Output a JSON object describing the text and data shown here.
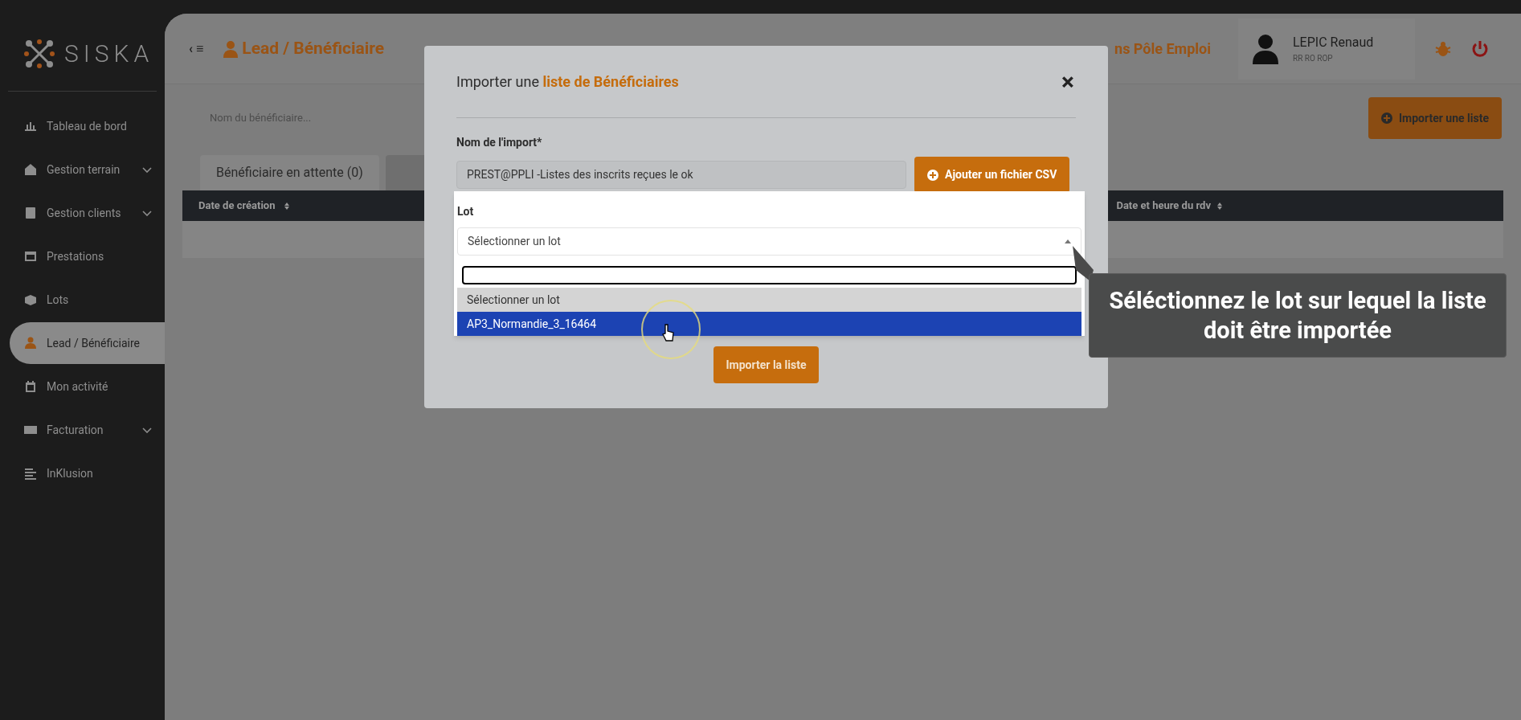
{
  "sidebar": {
    "logo": "SISKA",
    "items": [
      {
        "label": "Tableau de bord",
        "submenu": false,
        "selected": false
      },
      {
        "label": "Gestion terrain",
        "submenu": true,
        "selected": false
      },
      {
        "label": "Gestion clients",
        "submenu": true,
        "selected": false
      },
      {
        "label": "Prestations",
        "submenu": false,
        "selected": false
      },
      {
        "label": "Lots",
        "submenu": false,
        "selected": false
      },
      {
        "label": "Lead / Bénéficiaire",
        "submenu": false,
        "selected": true
      },
      {
        "label": "Mon activité",
        "submenu": false,
        "selected": false
      },
      {
        "label": "Facturation",
        "submenu": true,
        "selected": false
      },
      {
        "label": "InKlusion",
        "submenu": false,
        "selected": false
      }
    ]
  },
  "header": {
    "toggle": "‹ ≡",
    "title": "Lead / Bénéficiaire",
    "link": "ns Pôle Emploi",
    "user_name": "LEPIC Renaud",
    "user_role": "RR RO ROP"
  },
  "toolbar": {
    "search_placeholder": "Nom du bénéficiaire...",
    "import_button": "Importer une liste"
  },
  "tabs": [
    {
      "label": "Bénéficiaire en attente (0)",
      "selected": true
    },
    {
      "selected": false
    }
  ],
  "table": {
    "columns": [
      "Date de création",
      "Date et heure du rdv"
    ]
  },
  "modal": {
    "title_plain": "Importer une ",
    "title_accent": "liste de Bénéficiaires",
    "close": "×",
    "name_label": "Nom de l'import*",
    "name_value": "PREST@PPLI -Listes des inscrits reçues le ok",
    "csv_button": "Ajouter un fichier CSV",
    "lot_label": "Lot",
    "lot_value": "Sélectionner un lot",
    "options": [
      {
        "kind": "placeholder",
        "label": "Sélectionner un lot",
        "selected": false
      },
      {
        "kind": "option",
        "label": "AP3_Normandie_3_16464",
        "selected": true
      }
    ],
    "submit": "Importer la liste"
  },
  "tooltip": {
    "text": "Séléctionnez le lot sur lequel la liste doit être importée"
  }
}
